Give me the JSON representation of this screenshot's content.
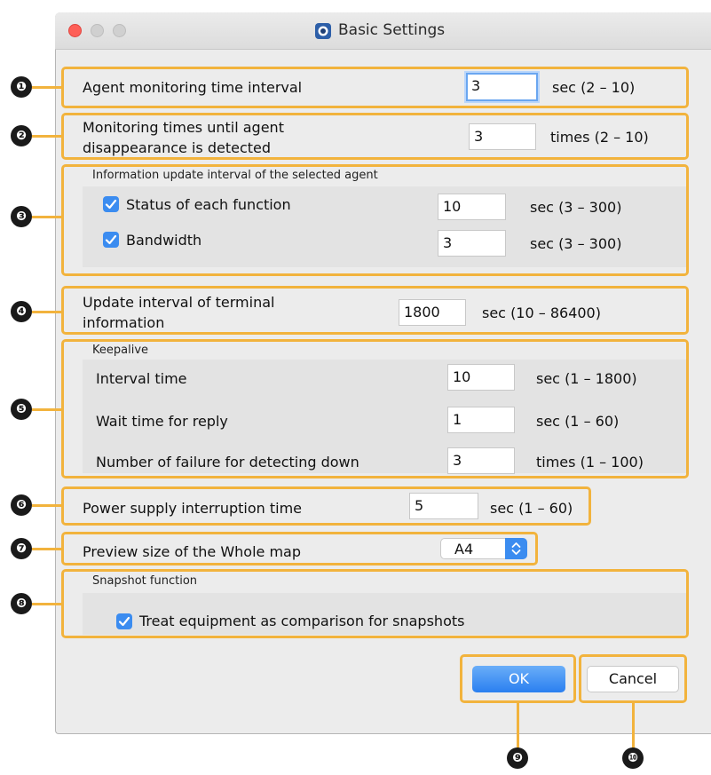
{
  "window": {
    "title": "Basic Settings"
  },
  "rows": {
    "agent_interval": {
      "label": "Agent monitoring time interval",
      "value": "3",
      "range": "sec (2 – 10)"
    },
    "monitoring_times": {
      "label_line1": "Monitoring times until agent",
      "label_line2": "disappearance is detected",
      "value": "3",
      "range": "times (2 – 10)"
    },
    "info_update": {
      "group_label": "Information update interval of the selected agent",
      "status_label": "Status of each function",
      "status_value": "10",
      "status_range": "sec (3 – 300)",
      "bandwidth_label": "Bandwidth",
      "bandwidth_value": "3",
      "bandwidth_range": "sec (3 – 300)"
    },
    "terminal_update": {
      "label_line1": "Update interval of terminal",
      "label_line2": "information",
      "value": "1800",
      "range": "sec (10 – 86400)"
    },
    "keepalive": {
      "group_label": "Keepalive",
      "interval_label": "Interval time",
      "interval_value": "10",
      "interval_range": "sec (1 – 1800)",
      "wait_label": "Wait time for reply",
      "wait_value": "1",
      "wait_range": "sec (1 – 60)",
      "failure_label": "Number of failure for detecting down",
      "failure_value": "3",
      "failure_range": "times (1 – 100)"
    },
    "power": {
      "label": "Power supply interruption time",
      "value": "5",
      "range": "sec (1 – 60)"
    },
    "preview": {
      "label": "Preview size of the Whole map",
      "selected": "A4"
    },
    "snapshot": {
      "group_label": "Snapshot function",
      "checkbox_label": "Treat equipment as comparison for snapshots"
    }
  },
  "buttons": {
    "ok": "OK",
    "cancel": "Cancel"
  },
  "markers": [
    "❶",
    "❷",
    "❸",
    "❹",
    "❺",
    "❻",
    "❼",
    "❽",
    "❾",
    "❿"
  ],
  "colors": {
    "highlight": "#f2b33d",
    "accent": "#3b8cf0",
    "close": "#fe5f57",
    "inactive_light": "#d0d0d0"
  },
  "icons": {
    "checkbox": "checkmark-icon",
    "select": "up-down-chevron-icon",
    "app": "app-logo-icon"
  }
}
